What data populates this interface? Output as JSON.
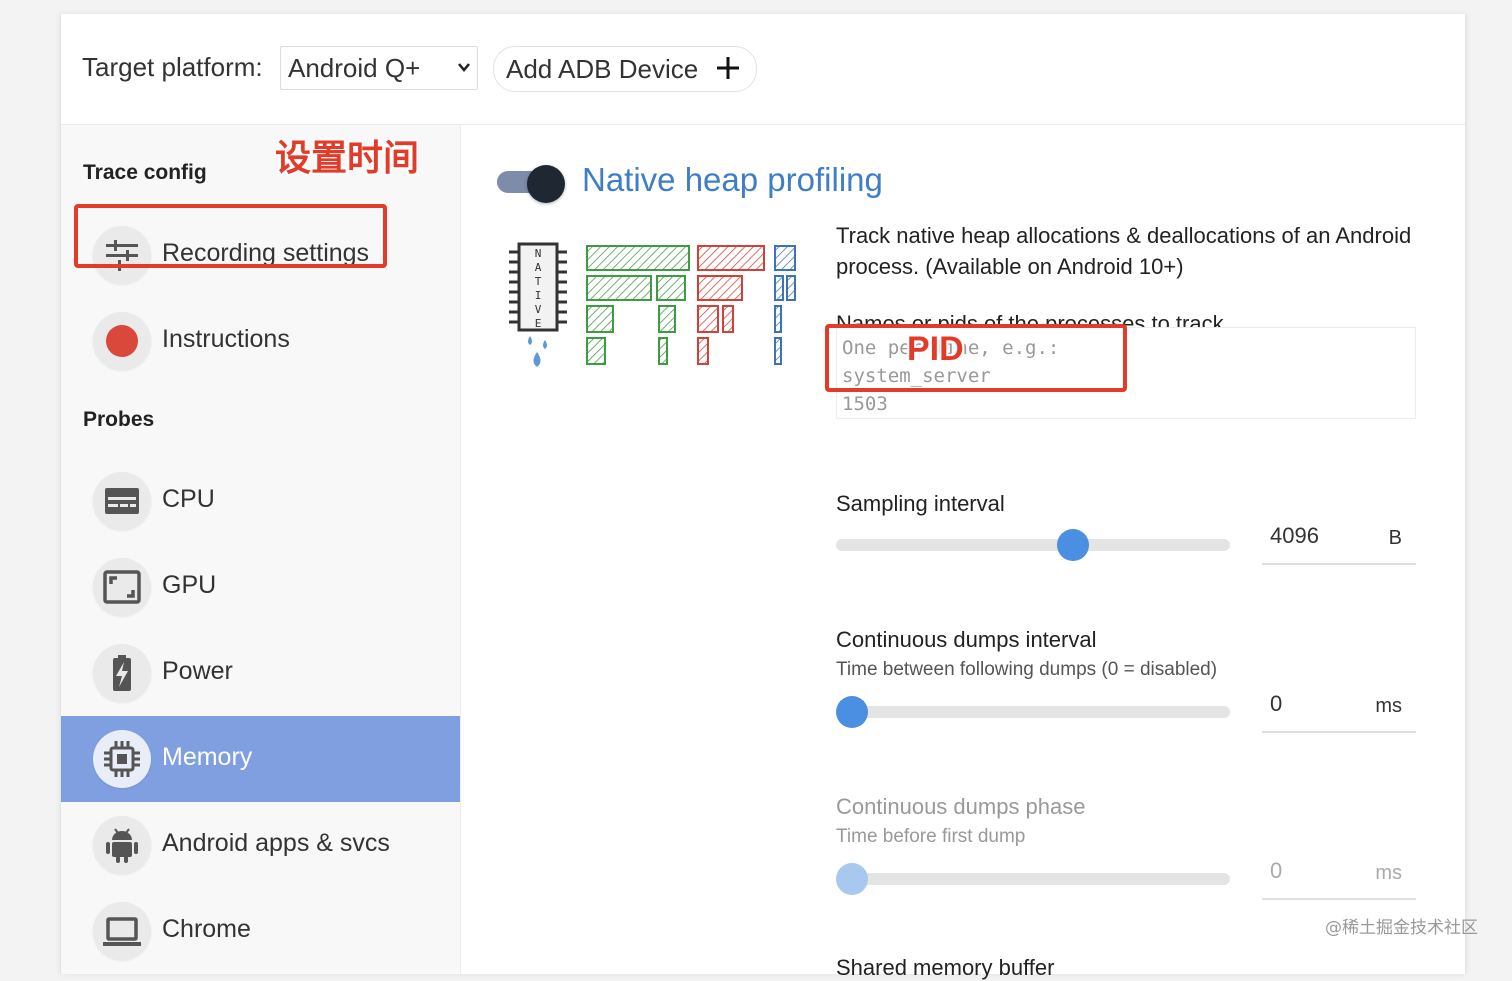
{
  "header": {
    "target_label": "Target platform:",
    "target_value": "Android Q+",
    "add_adb_label": "Add ADB Device"
  },
  "sidebar": {
    "trace_config_title": "Trace config",
    "annotation_time": "设置时间",
    "items_top": [
      {
        "label": "Recording settings",
        "icon": "sliders-icon"
      },
      {
        "label": "Instructions",
        "icon": "record-dot-icon"
      }
    ],
    "probes_title": "Probes",
    "items_probes": [
      {
        "label": "CPU",
        "icon": "cpu-icon"
      },
      {
        "label": "GPU",
        "icon": "gpu-icon"
      },
      {
        "label": "Power",
        "icon": "battery-icon"
      },
      {
        "label": "Memory",
        "icon": "memory-chip-icon",
        "active": true
      },
      {
        "label": "Android apps & svcs",
        "icon": "android-icon"
      },
      {
        "label": "Chrome",
        "icon": "laptop-icon"
      }
    ]
  },
  "main": {
    "probe_title": "Native heap profiling",
    "toggle_on": true,
    "illustration_letters": [
      "N",
      "A",
      "T",
      "I",
      "V",
      "E"
    ],
    "description": "Track native heap allocations & deallocations of an Android process. (Available on Android 10+)",
    "process_label": "Names or pids of the processes to track",
    "process_placeholder": "One per line, e.g.:\nsystem_server\n1503",
    "pid_annotation": "PID",
    "sampling_label": "Sampling interval",
    "sampling_value": "4096",
    "sampling_unit": "B",
    "sampling_fraction": 0.61,
    "dumps_interval_label": "Continuous dumps interval",
    "dumps_interval_sub": "Time between following dumps (0 = disabled)",
    "dumps_interval_value": "0",
    "dumps_interval_unit": "ms",
    "dumps_interval_fraction": 0.0,
    "dumps_phase_label": "Continuous dumps phase",
    "dumps_phase_sub": "Time before first dump",
    "dumps_phase_value": "0",
    "dumps_phase_unit": "ms",
    "dumps_phase_fraction": 0.0,
    "shared_memory_label": "Shared memory buffer"
  },
  "watermark": "@稀土掘金技术社区",
  "colors": {
    "accent": "#3e7ec6",
    "active_nav": "#7f9fe0",
    "annotation_red": "#e23b2a",
    "slider_thumb": "#4b8fe2"
  }
}
